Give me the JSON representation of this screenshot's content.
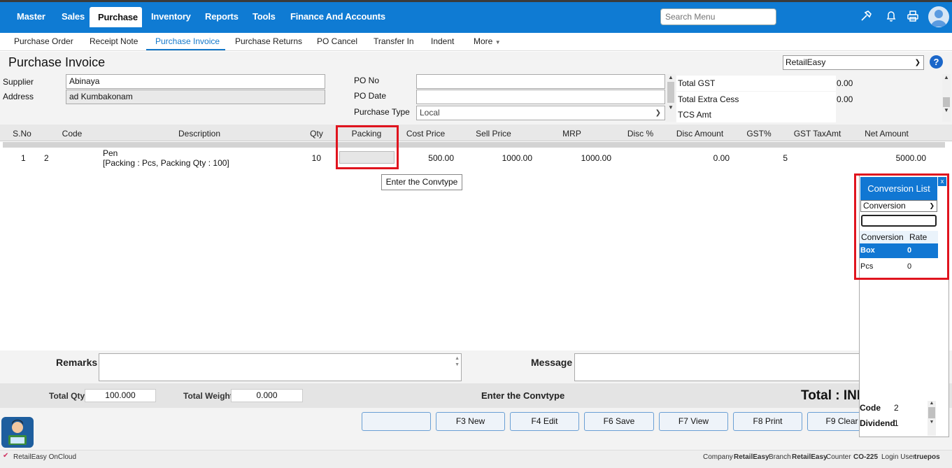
{
  "topnav": {
    "items": [
      "Master",
      "Sales",
      "Purchase",
      "Inventory",
      "Reports",
      "Tools",
      "Finance And Accounts"
    ],
    "active": "Purchase",
    "search_placeholder": "Search Menu",
    "icons": [
      "hammer-icon",
      "bell-icon",
      "printer-icon",
      "user-avatar-icon"
    ]
  },
  "subnav": {
    "items": [
      "Purchase Order",
      "Receipt Note",
      "Purchase Invoice",
      "Purchase Returns",
      "PO Cancel",
      "Transfer In",
      "Indent",
      "More"
    ],
    "active": "Purchase Invoice"
  },
  "page": {
    "title": "Purchase Invoice",
    "company": "RetailEasy",
    "help": "?"
  },
  "form": {
    "supplier_label": "Supplier",
    "supplier_value": "Abinaya",
    "address_label": "Address",
    "address_value": "ad Kumbakonam",
    "po_no_label": "PO No",
    "po_no_value": "",
    "po_date_label": "PO Date",
    "po_date_value": "",
    "purchase_type_label": "Purchase Type",
    "purchase_type_value": "Local"
  },
  "summary": [
    {
      "label": "Total GST",
      "value": "0.00"
    },
    {
      "label": "Total Extra Cess",
      "value": "0.00"
    },
    {
      "label": "TCS Amt",
      "value": ""
    }
  ],
  "table": {
    "headers": [
      "S.No",
      "Code",
      "Description",
      "Qty",
      "Packing",
      "Cost Price",
      "Sell Price",
      "MRP",
      "Disc %",
      "Disc Amount",
      "GST%",
      "GST TaxAmt",
      "Net Amount"
    ],
    "rows": [
      {
        "sno": "1",
        "code": "2",
        "description": "Pen",
        "description_detail": "[Packing : Pcs, Packing Qty : 100]",
        "qty": "10",
        "packing": "",
        "cost_price": "500.00",
        "sell_price": "1000.00",
        "mrp": "1000.00",
        "disc_pct": "",
        "disc_amount": "0.00",
        "gst_pct": "5",
        "gst_taxamt": "",
        "net_amount": "5000.00"
      }
    ]
  },
  "tooltip": "Enter the Convtype",
  "conversion_list": {
    "title": "Conversion List",
    "close": "x",
    "select_value": "Conversion",
    "col_conversion": "Conversion",
    "col_rate": "Rate",
    "rows": [
      {
        "conversion": "Box",
        "rate": "0",
        "selected": true
      },
      {
        "conversion": "Pcs",
        "rate": "0",
        "selected": false
      }
    ],
    "footer": [
      {
        "label": "Code",
        "value": "2"
      },
      {
        "label": "Dividend",
        "value": "1"
      }
    ]
  },
  "bottom": {
    "remarks_label": "Remarks",
    "message_label": "Message",
    "total_qty_label": "Total Qty",
    "total_qty_value": "100.000",
    "total_weight_label": "Total Weight",
    "total_weight_value": "0.000",
    "status_message": "Enter the Convtype",
    "total_label": "Total : INR"
  },
  "buttons": [
    "",
    "F3 New",
    "F4 Edit",
    "F6 Save",
    "F7 View",
    "F8 Print",
    "F9 Clear"
  ],
  "statusbar": {
    "app_name": "RetailEasy OnCloud",
    "company_label": "Company",
    "company_value": "RetailEasy",
    "branch_label": "Branch",
    "branch_value": "RetailEasy",
    "counter_label": "Counter",
    "counter_value": "CO-225",
    "user_label": "Login User",
    "user_value": "truepos"
  },
  "colors": {
    "primary": "#0f7bd3",
    "highlight": "#e0141e"
  }
}
